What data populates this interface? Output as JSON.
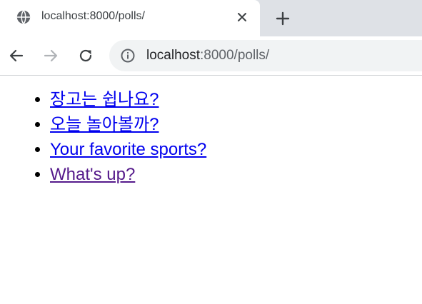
{
  "browser": {
    "tab": {
      "title": "localhost:8000/polls/"
    },
    "address_bar": {
      "host": "localhost",
      "rest": ":8000/polls/"
    }
  },
  "page": {
    "polls": [
      {
        "text": "장고는 쉽나요?",
        "visited": false
      },
      {
        "text": "오늘 놀아볼까?",
        "visited": false
      },
      {
        "text": "Your favorite sports?",
        "visited": false
      },
      {
        "text": "What's up?",
        "visited": true
      }
    ]
  }
}
